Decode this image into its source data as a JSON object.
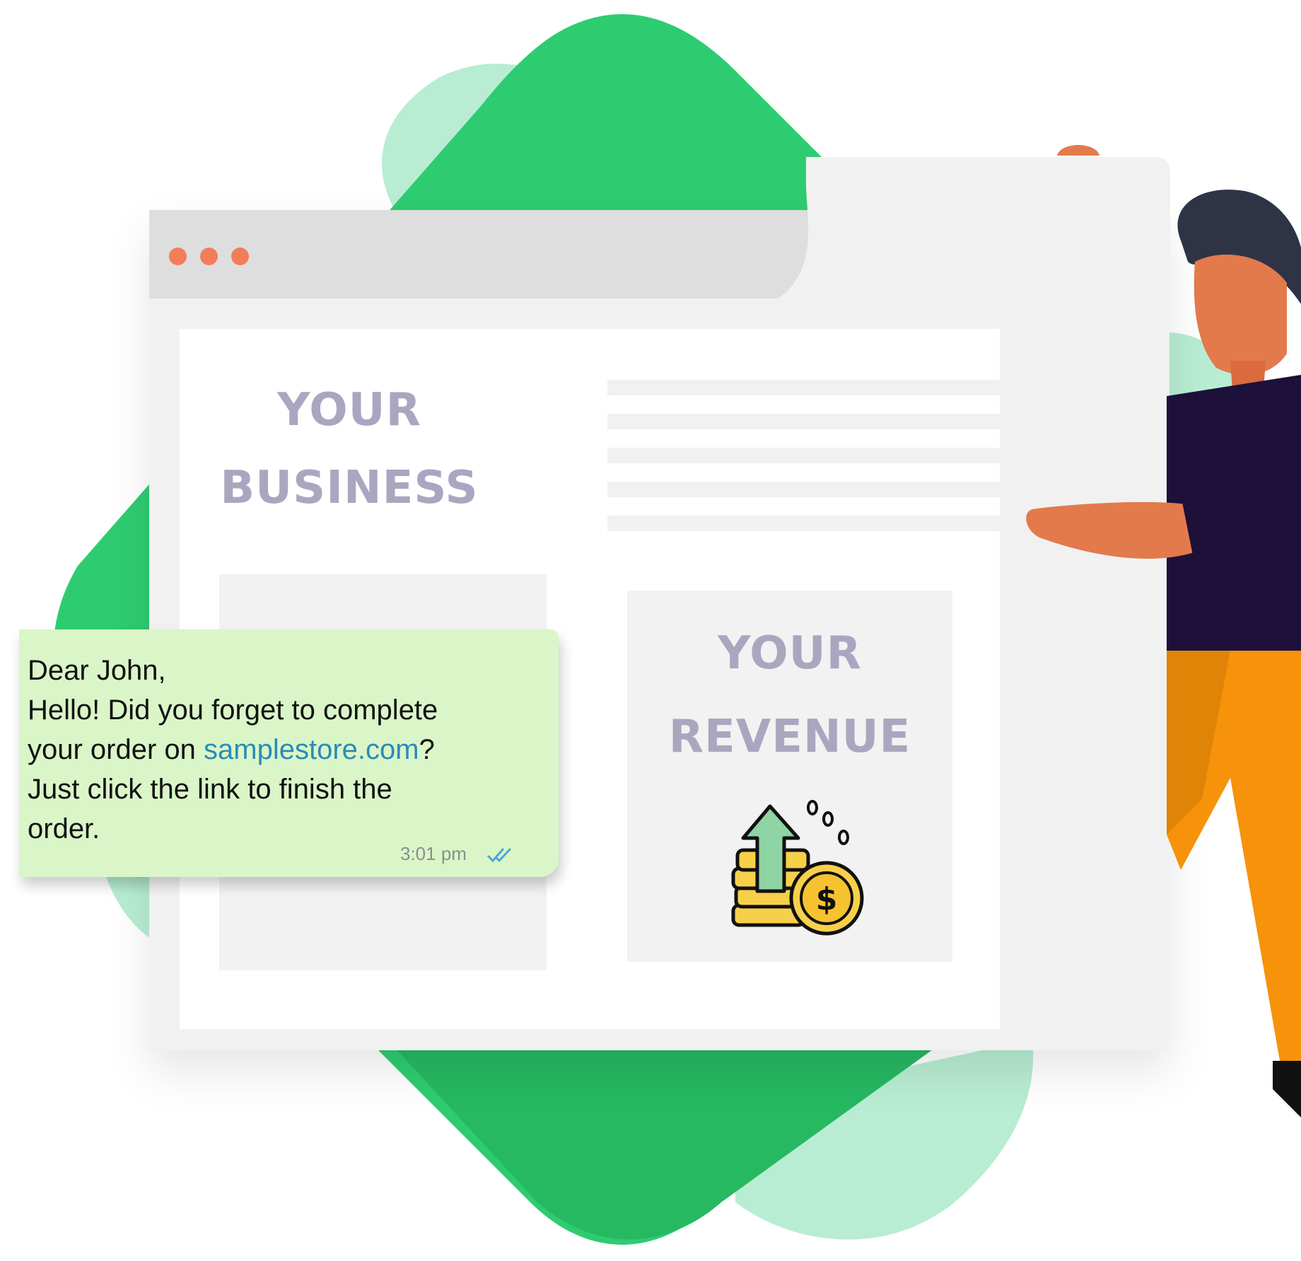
{
  "colors": {
    "brand_green": "#2ecc71",
    "light_green": "#b8edd3",
    "bubble_green": "#daf6c8",
    "heading_gray": "#a9a7c0",
    "window_dot": "#f27d5a",
    "link": "#2a8bb8"
  },
  "browser": {
    "dots": [
      "dot",
      "dot",
      "dot"
    ],
    "heading_business": [
      "YOUR",
      "BUSINESS"
    ],
    "heading_revenue": [
      "YOUR",
      "REVENUE"
    ]
  },
  "message": {
    "greeting": "Dear John,",
    "line1": "Hello! Did you forget to complete",
    "line2_prefix": "your order on ",
    "link_text": "samplestore.com",
    "line2_suffix": "?",
    "line3": "Just click the link to finish the",
    "line4": "order.",
    "time": "3:01 pm",
    "status_icon": "double-check-icon"
  },
  "icons": {
    "revenue": "revenue-coins-arrow-icon",
    "person": "presenting-person-illustration"
  }
}
